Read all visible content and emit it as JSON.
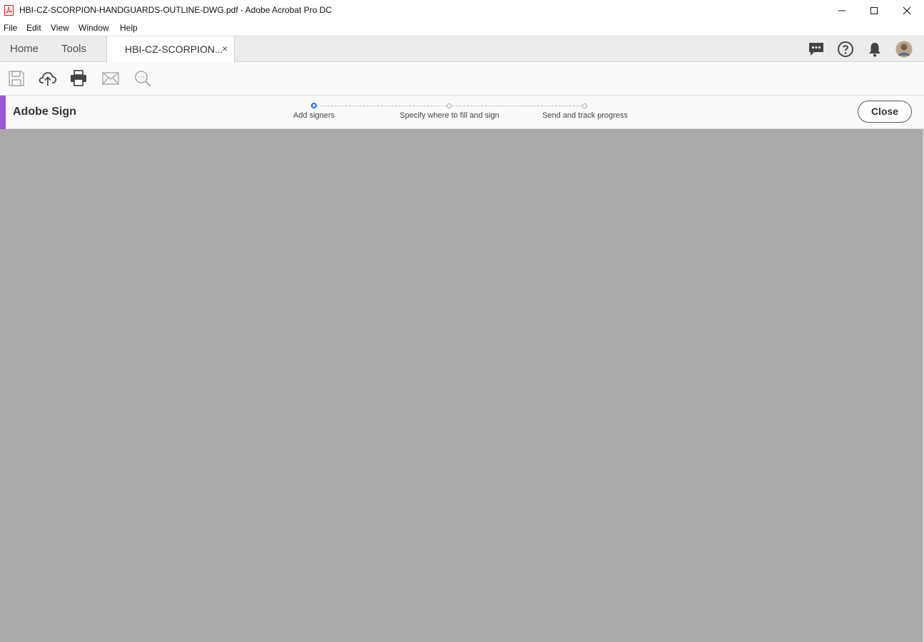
{
  "window": {
    "title": "HBI-CZ-SCORPION-HANDGUARDS-OUTLINE-DWG.pdf - Adobe Acrobat Pro DC",
    "app_icon": "acrobat-pdf-icon",
    "controls": [
      "minimize-icon",
      "maximize-icon",
      "close-icon"
    ]
  },
  "menu": {
    "items": [
      "File",
      "Edit",
      "View",
      "Window",
      "Help"
    ]
  },
  "tabs": {
    "home": "Home",
    "tools": "Tools",
    "document": "HBI-CZ-SCORPION...",
    "document_close": "×"
  },
  "top_right_icons": [
    "comment-icon",
    "help-icon",
    "notification-bell-icon",
    "user-avatar"
  ],
  "toolbar": {
    "icons": [
      "save-icon",
      "upload-cloud-icon",
      "print-icon",
      "email-icon",
      "zoom-search-icon"
    ]
  },
  "sign": {
    "title": "Adobe Sign",
    "steps": [
      {
        "label": "Add signers",
        "active": true
      },
      {
        "label": "Specify where to fill and sign",
        "active": false
      },
      {
        "label": "Send and track progress",
        "active": false
      }
    ],
    "close_label": "Close"
  },
  "colors": {
    "accent": "#9a56d7",
    "active_step": "#1473e6",
    "canvas": "#a9a9a9"
  }
}
